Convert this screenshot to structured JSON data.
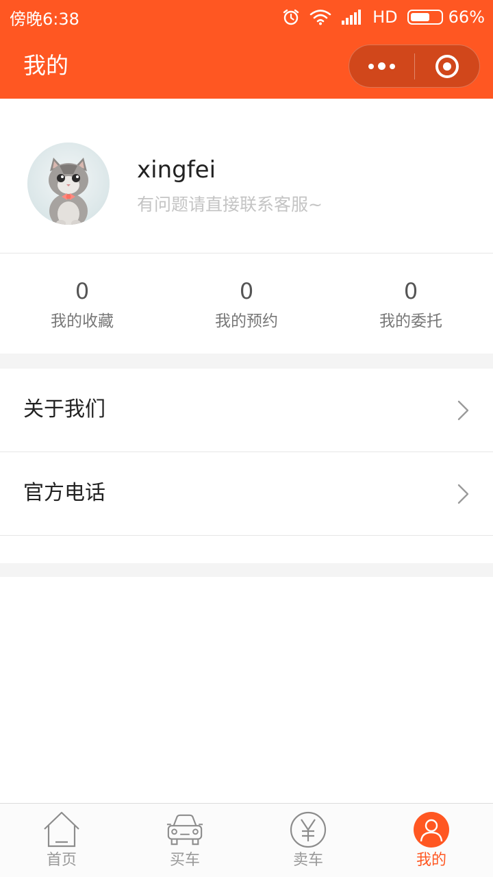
{
  "status_bar": {
    "time": "傍晚6:38",
    "network": "HD",
    "battery": "66%",
    "battery_level": 0.66,
    "icons": [
      "alarm-icon",
      "wifi-icon",
      "signal-icon",
      "battery-icon"
    ]
  },
  "nav": {
    "title": "我的",
    "more_icon": "more-dots-icon",
    "close_icon": "target-icon"
  },
  "profile": {
    "username": "xingfei",
    "tagline": "有问题请直接联系客服~",
    "avatar_icon": "kitten-avatar"
  },
  "stats": [
    {
      "count": "0",
      "label": "我的收藏"
    },
    {
      "count": "0",
      "label": "我的预约"
    },
    {
      "count": "0",
      "label": "我的委托"
    }
  ],
  "menu": [
    {
      "label": "关于我们",
      "icon": "chevron-right-icon"
    },
    {
      "label": "官方电话",
      "icon": "chevron-right-icon"
    }
  ],
  "tabs": [
    {
      "label": "首页",
      "icon": "home-icon",
      "active": false
    },
    {
      "label": "买车",
      "icon": "car-icon",
      "active": false
    },
    {
      "label": "卖车",
      "icon": "yen-icon",
      "active": false
    },
    {
      "label": "我的",
      "icon": "user-icon",
      "active": true
    }
  ],
  "colors": {
    "brand": "#ff5722",
    "background": "#ffffff",
    "band": "#f4f4f4",
    "inactive_tab": "#999999"
  }
}
